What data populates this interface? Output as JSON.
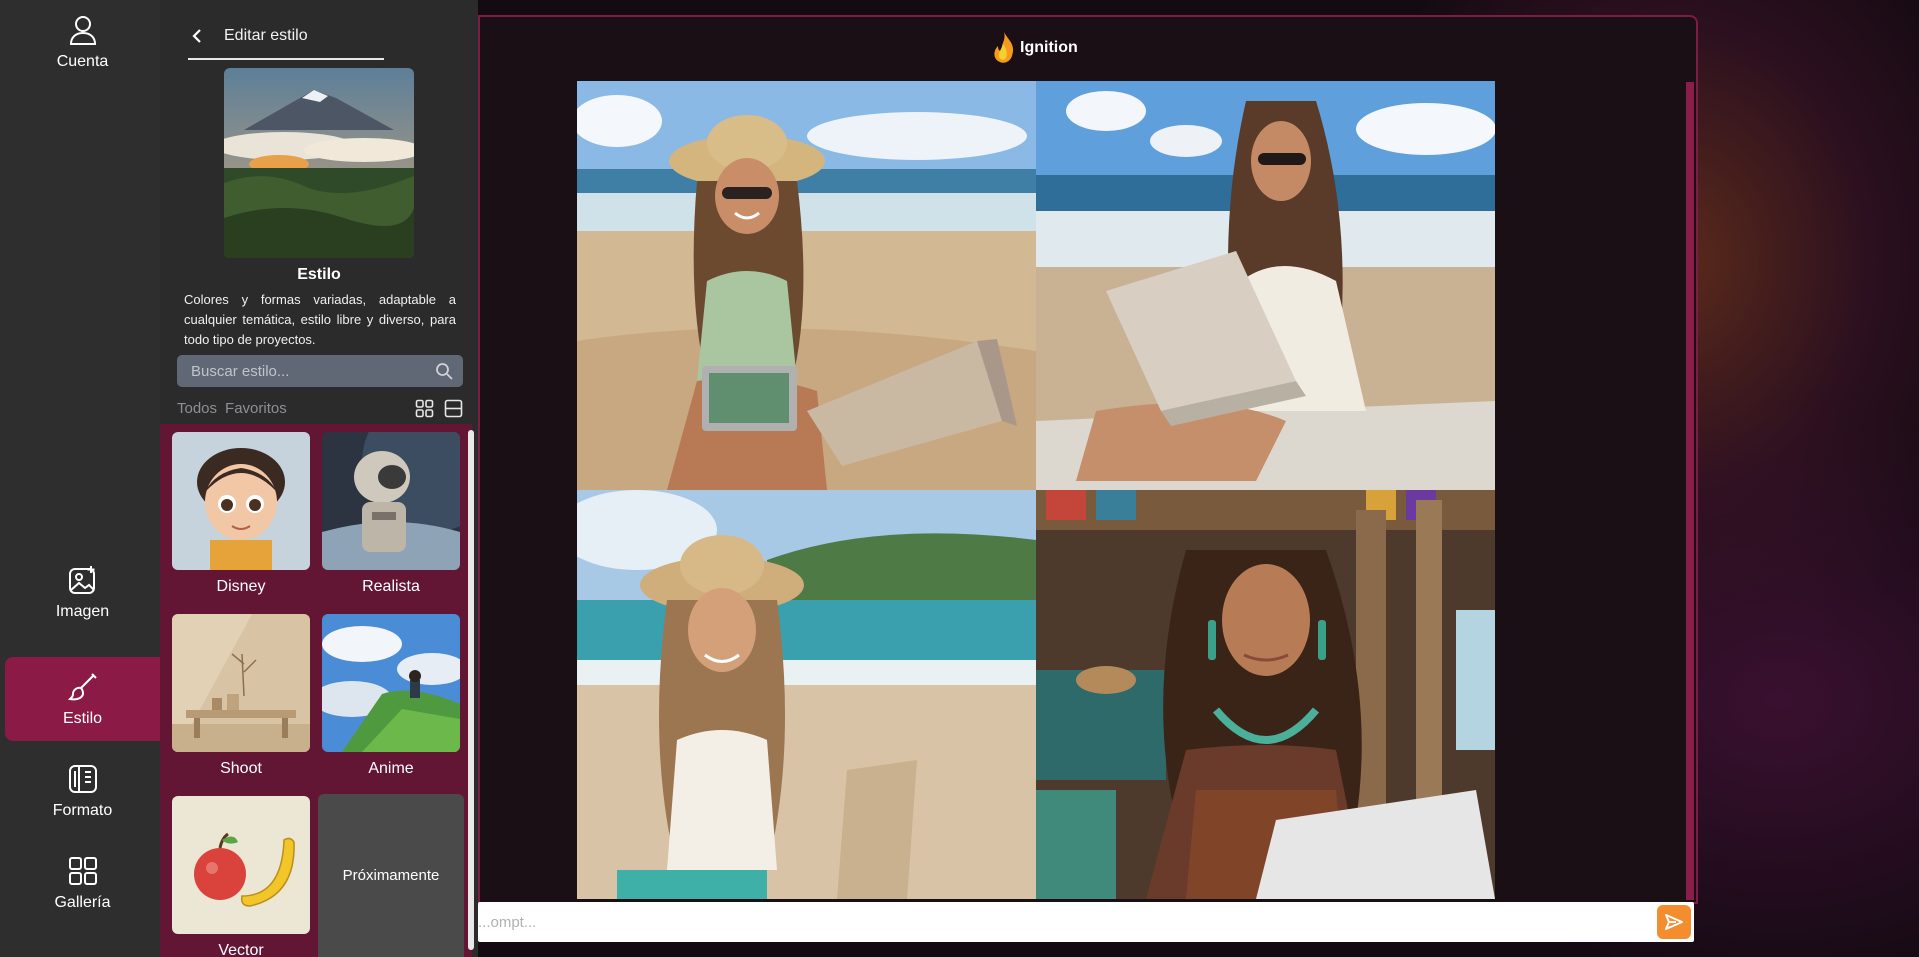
{
  "rail": {
    "items": [
      {
        "label": "Cuenta",
        "icon": "user-icon"
      },
      {
        "label": "Imagen",
        "icon": "image-edit-icon"
      },
      {
        "label": "Estilo",
        "icon": "brush-icon"
      },
      {
        "label": "Formato",
        "icon": "format-icon"
      },
      {
        "label": "Gallería",
        "icon": "gallery-grid-icon"
      }
    ],
    "active": "Estilo",
    "active_color": "#8b1a46"
  },
  "panel": {
    "back_title": "Editar estilo",
    "style_name": "Estilo",
    "style_description": "Colores y formas variadas, adaptable a cualquier temática, estilo libre y diverso, para todo tipo de proyectos.",
    "search_placeholder": "Buscar estilo...",
    "filters": {
      "all": "Todos",
      "favorites": "Favoritos"
    },
    "styles": [
      {
        "label": "Disney"
      },
      {
        "label": "Realista"
      },
      {
        "label": "Shoot"
      },
      {
        "label": "Anime"
      },
      {
        "label": "Vector"
      }
    ],
    "coming_soon": "Próximamente"
  },
  "main": {
    "logo_text": "Ignition",
    "prompt_placeholder": "...ompt...",
    "accent_color": "#f38d2d"
  }
}
